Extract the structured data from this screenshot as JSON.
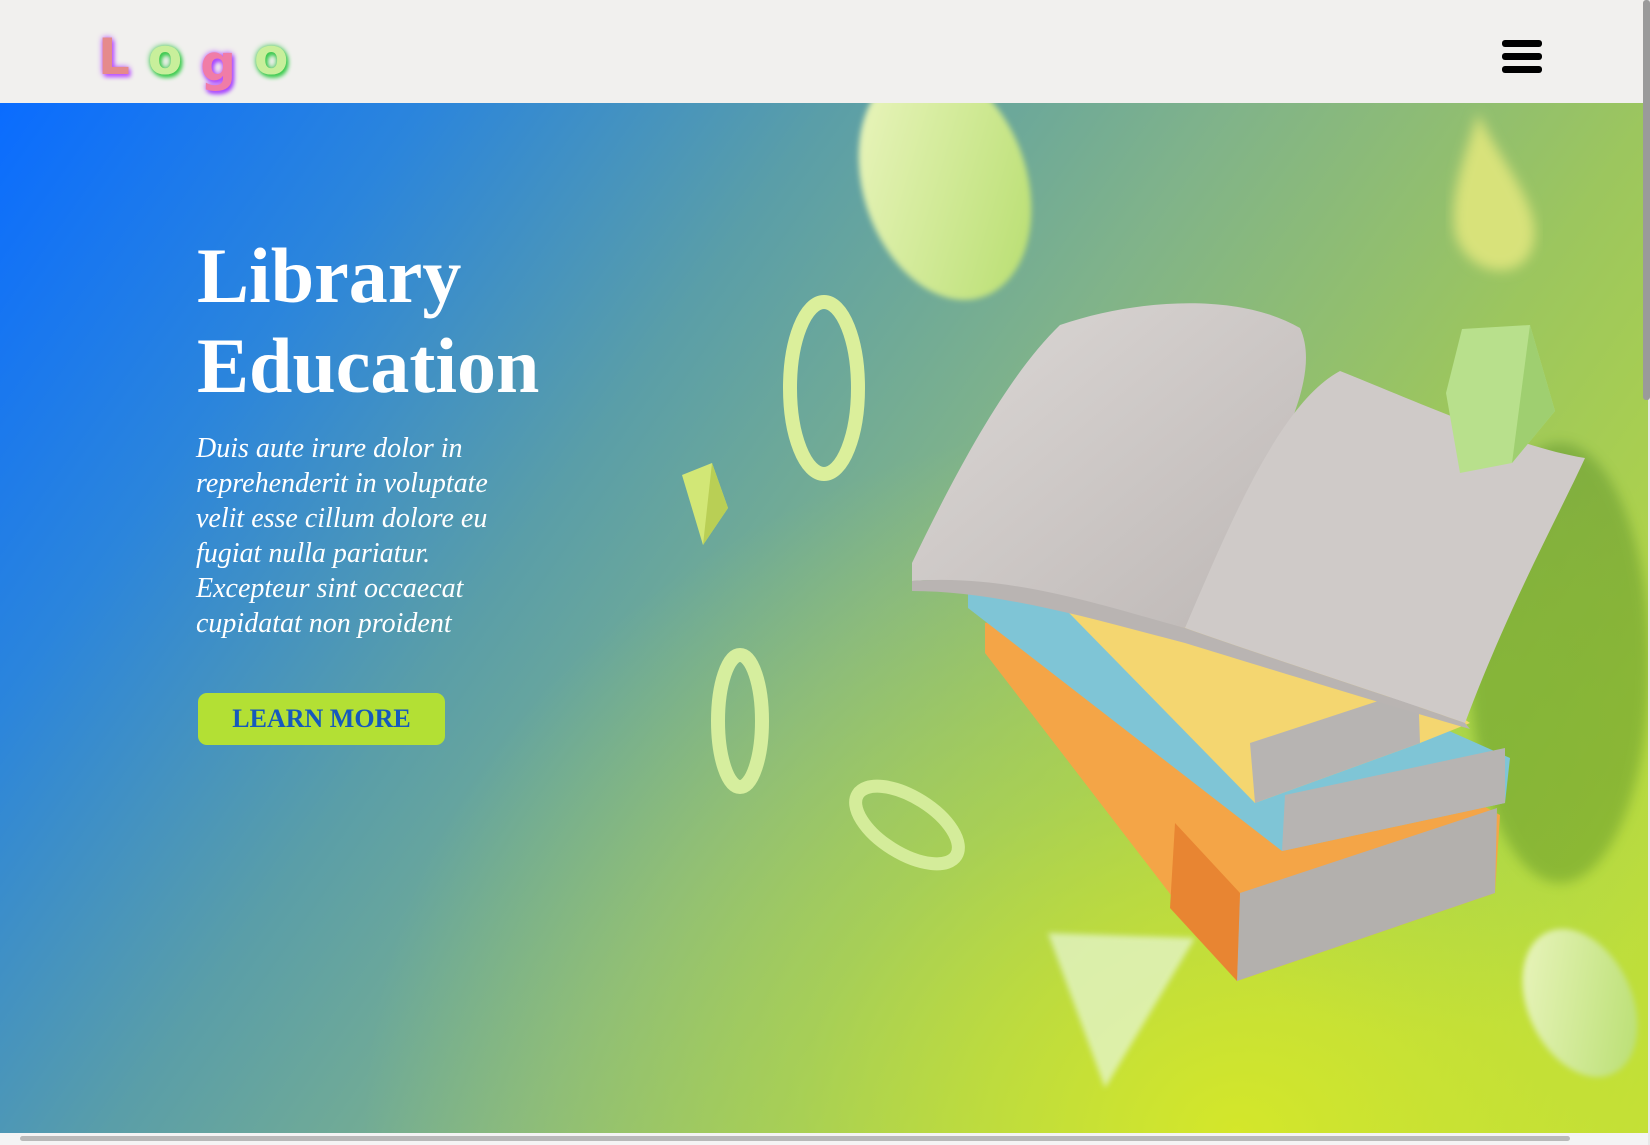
{
  "header": {
    "logo_letters": [
      "L",
      "o",
      "g",
      "o"
    ],
    "menu_icon": "hamburger-menu-icon"
  },
  "hero": {
    "title_line1": "Library",
    "title_line2": "Education",
    "description": "Duis aute irure dolor in reprehenderit in voluptate velit esse cillum dolore eu fugiat nulla pariatur. Excepteur sint occaecat cupidatat non proident",
    "cta_label": "LEARN MORE",
    "illustration": "stack-of-books-with-open-book"
  },
  "colors": {
    "header_bg": "#f1f0ee",
    "gradient_start": "#0a6cff",
    "gradient_end": "#c8e030",
    "cta_bg": "#b3e034",
    "cta_text": "#1659bd",
    "title_text": "#ffffff"
  }
}
